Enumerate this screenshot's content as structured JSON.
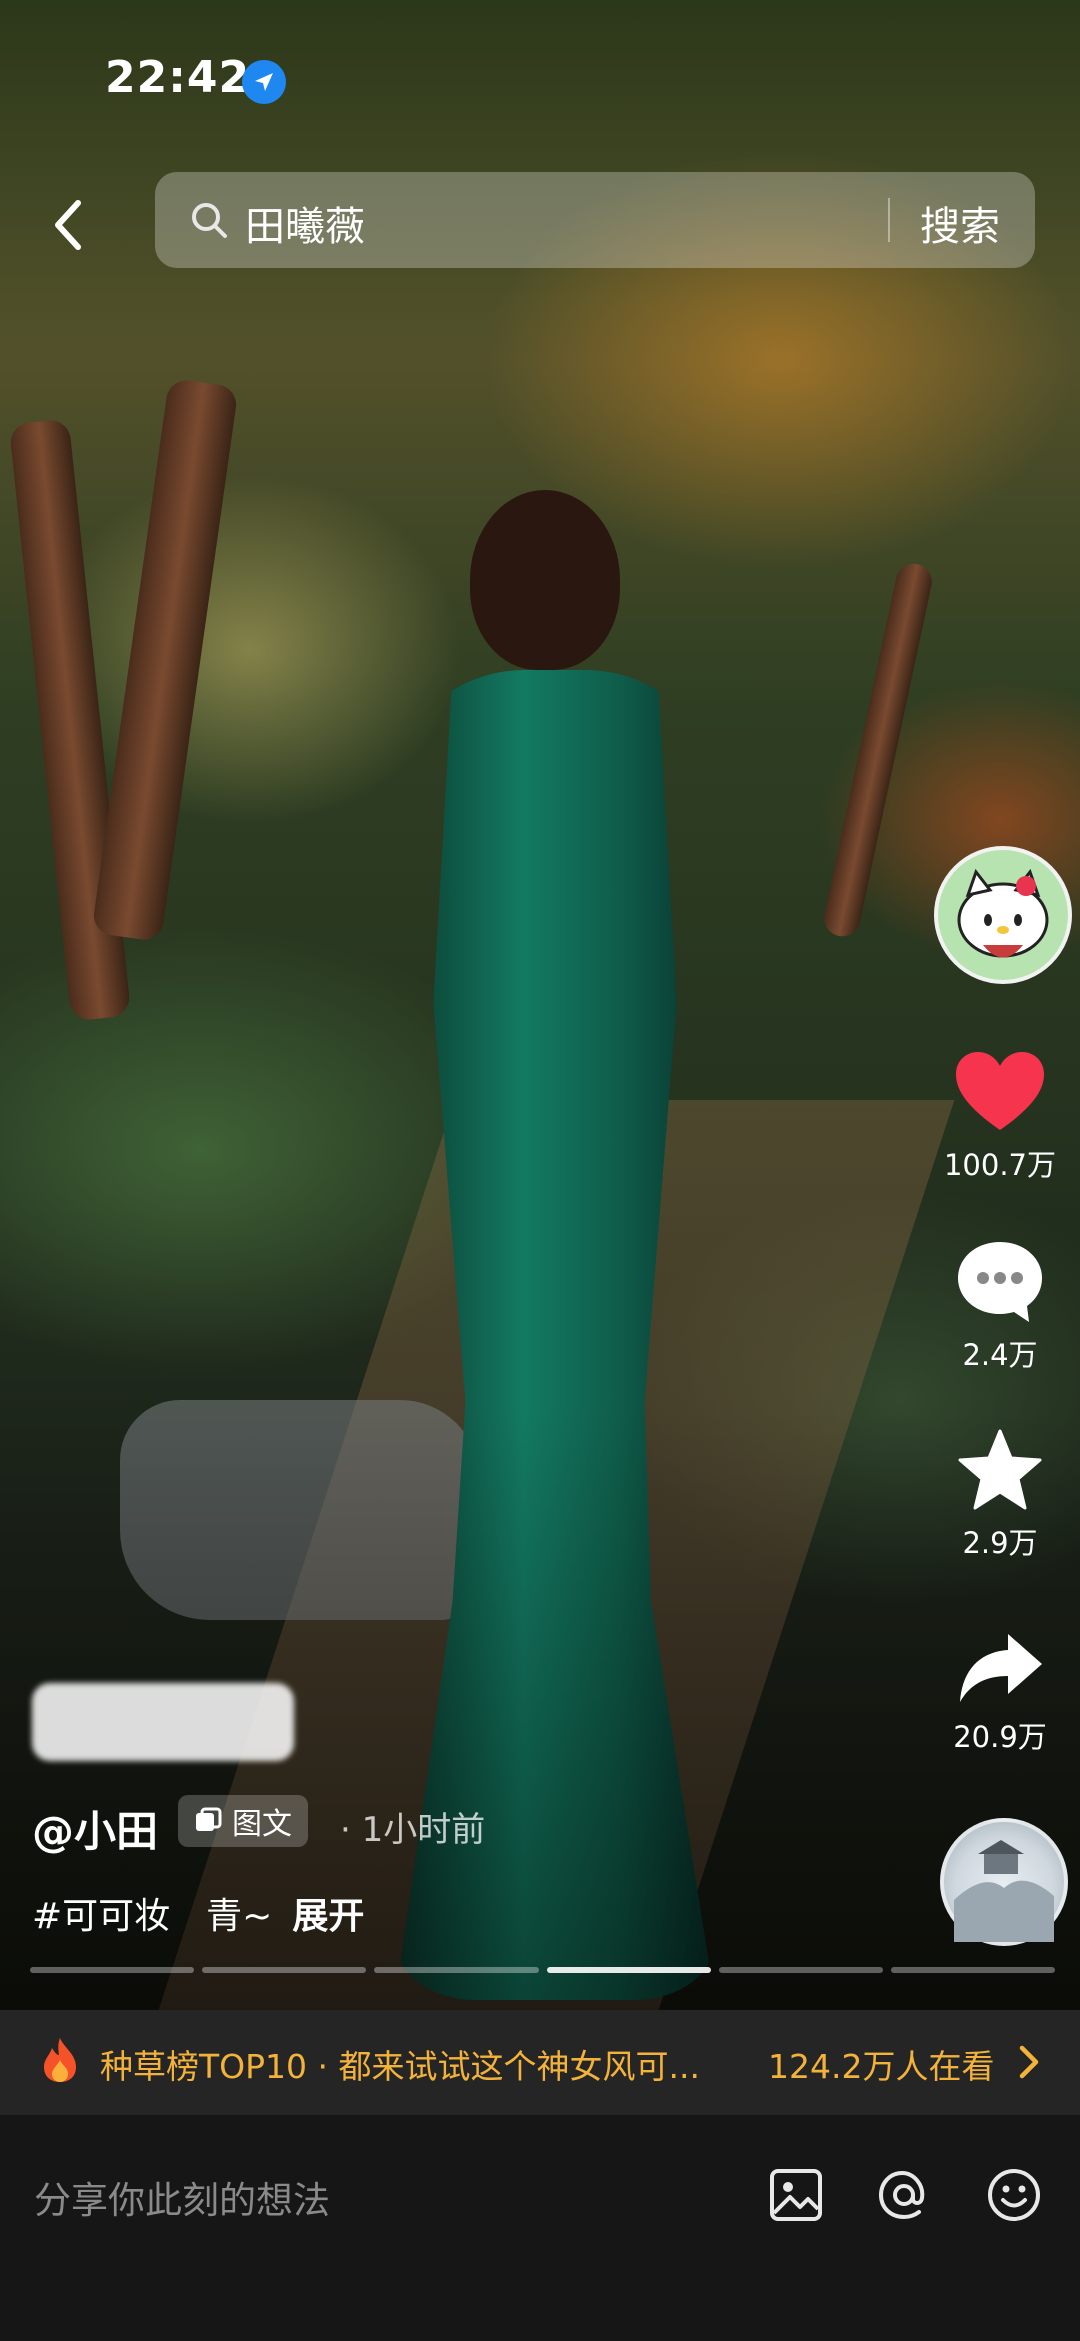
{
  "status_bar": {
    "time": "22:42"
  },
  "search": {
    "query": "田曦薇",
    "button_label": "搜索"
  },
  "actions": {
    "like_count": "100.7万",
    "comment_count": "2.4万",
    "favorite_count": "2.9万",
    "share_count": "20.9万"
  },
  "post": {
    "author": "@小田",
    "type_label": "图文",
    "time_ago": "· 1小时前",
    "caption": "#可可妆　青~",
    "expand_label": "展开",
    "progress": {
      "segments": 6,
      "active_index": 3
    }
  },
  "trend": {
    "text": "种草榜TOP10 · 都来试试这个神女风可...",
    "count": "124.2万人在看"
  },
  "comment_bar": {
    "placeholder": "分享你此刻的想法"
  },
  "colors": {
    "like": "#f7344e",
    "trend_text": "#f3b23a",
    "location": "#1e87f0"
  }
}
